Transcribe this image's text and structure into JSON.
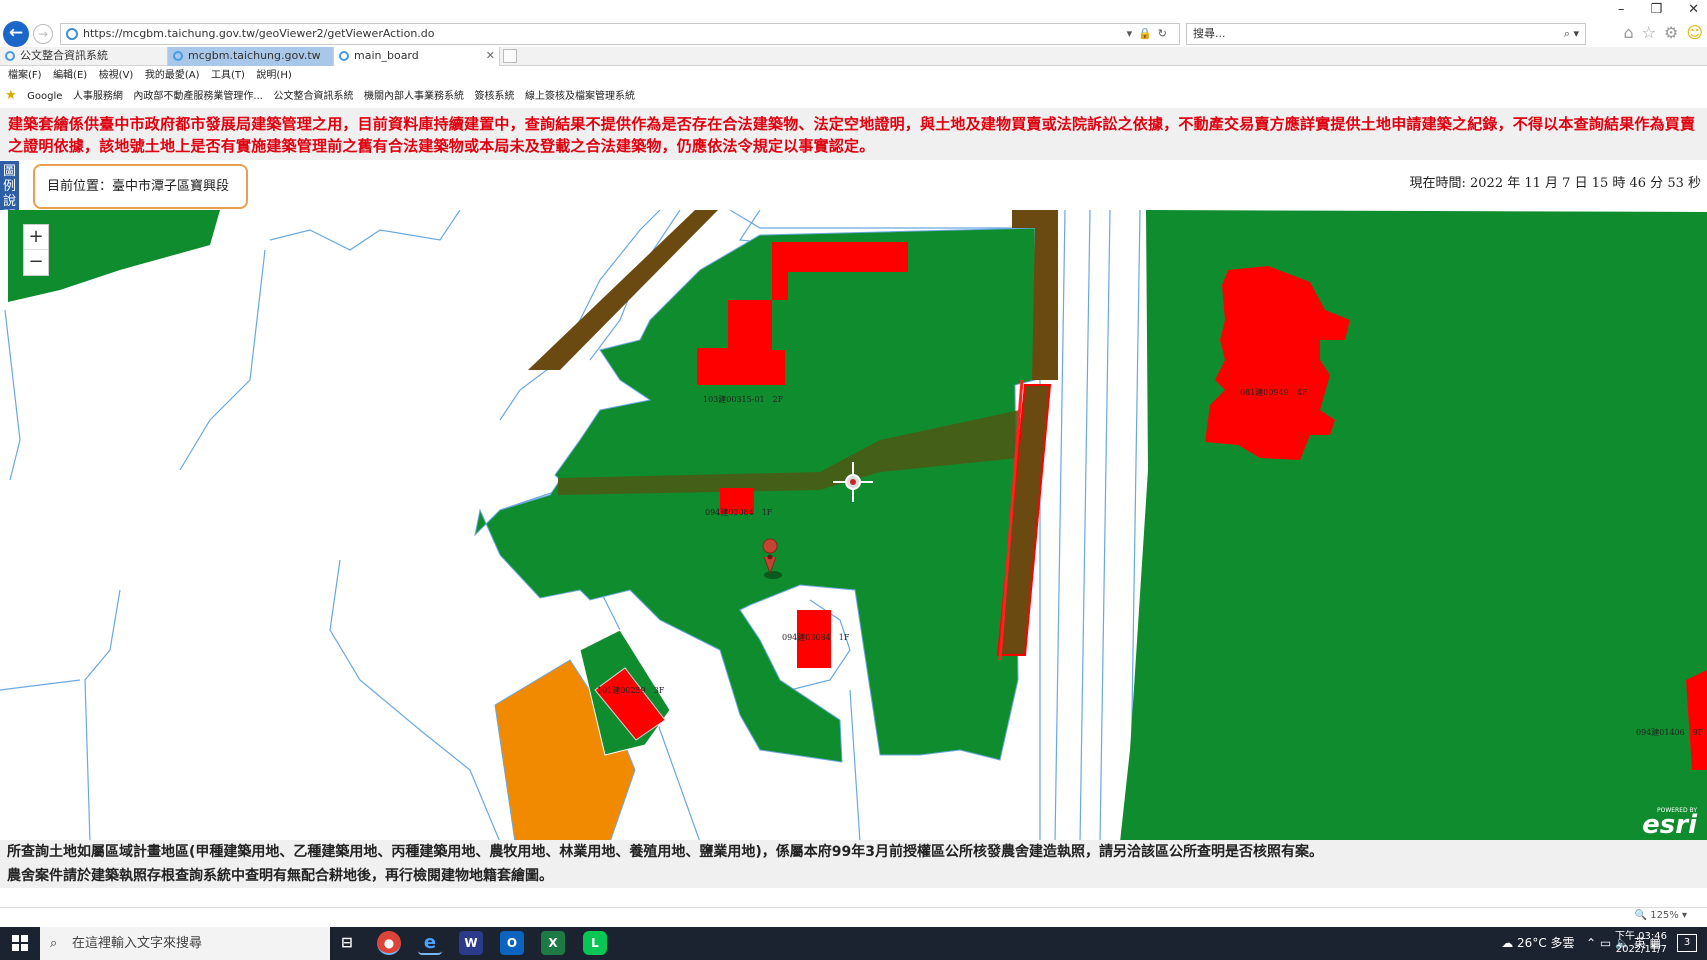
{
  "browser": {
    "url": "https://mcgbm.taichung.gov.tw/geoViewer2/getViewerAction.do",
    "search_placeholder": "搜尋...",
    "tabs": [
      {
        "label": "公文整合資訊系統"
      },
      {
        "label": "mcgbm.taichung.gov.tw"
      },
      {
        "label": "main_board"
      }
    ],
    "menu": [
      "檔案(F)",
      "編輯(E)",
      "檢視(V)",
      "我的最愛(A)",
      "工具(T)",
      "說明(H)"
    ],
    "favorites": [
      "Google",
      "人事服務網",
      "內政部不動產服務業管理作...",
      "公文整合資訊系統",
      "機關內部人事業務系統",
      "簽核系統",
      "線上簽核及檔案管理系統"
    ],
    "zoom_level": "125%"
  },
  "page": {
    "disclaimer": "建築套繪係供臺中市政府都市發展局建築管理之用，目前資料庫持續建置中，查詢結果不提供作為是否存在合法建築物、法定空地證明，與土地及建物買賣或法院訴訟之依據，不動產交易賣方應詳實提供土地申請建築之紀錄，不得以本查詢結果作為買賣之證明依據，該地號土地上是否有實施建築管理前之舊有合法建築物或本局未及登載之合法建築物，仍應依法令規定以事實認定。",
    "legend_label": "圖例說明",
    "location": "目前位置：臺中市潭子區寶興段",
    "current_time": "現在時間: 2022 年 11 月 7 日 15 時 46 分 53 秒",
    "note1": "所查詢土地如屬區域計畫地區(甲種建築用地、乙種建築用地、丙種建築用地、農牧用地、林業用地、養殖用地、鹽業用地)，係屬本府99年3月前授權區公所核發農舍建造執照，請另洽該區公所查明是否核照有案。",
    "note2": "農舍案件請於建築執照存根查詢系統中查明有無配合耕地後，再行檢閱建物地籍套繪圖。"
  },
  "map": {
    "zoom_in": "+",
    "zoom_out": "−",
    "building_labels": [
      "103建00315-01　2F",
      "081建00949　4F",
      "094建03084　1F",
      "094建03084　1F",
      "101建00259　3F",
      "094建01406　9F"
    ],
    "attribution_top": "POWERED BY",
    "attribution": "esri",
    "colors": {
      "zone_green": "#0f8c2d",
      "building_red": "#ff0000",
      "road_brown": "#6b4a12",
      "orange": "#f28a00",
      "parcel_line": "#6aa8e0"
    }
  },
  "taskbar": {
    "search_placeholder": "在這裡輸入文字來搜尋",
    "weather": "26°C 多雲",
    "ime": "英",
    "time": "下午 03:46",
    "date": "2022/11/7",
    "notifications": "3"
  }
}
